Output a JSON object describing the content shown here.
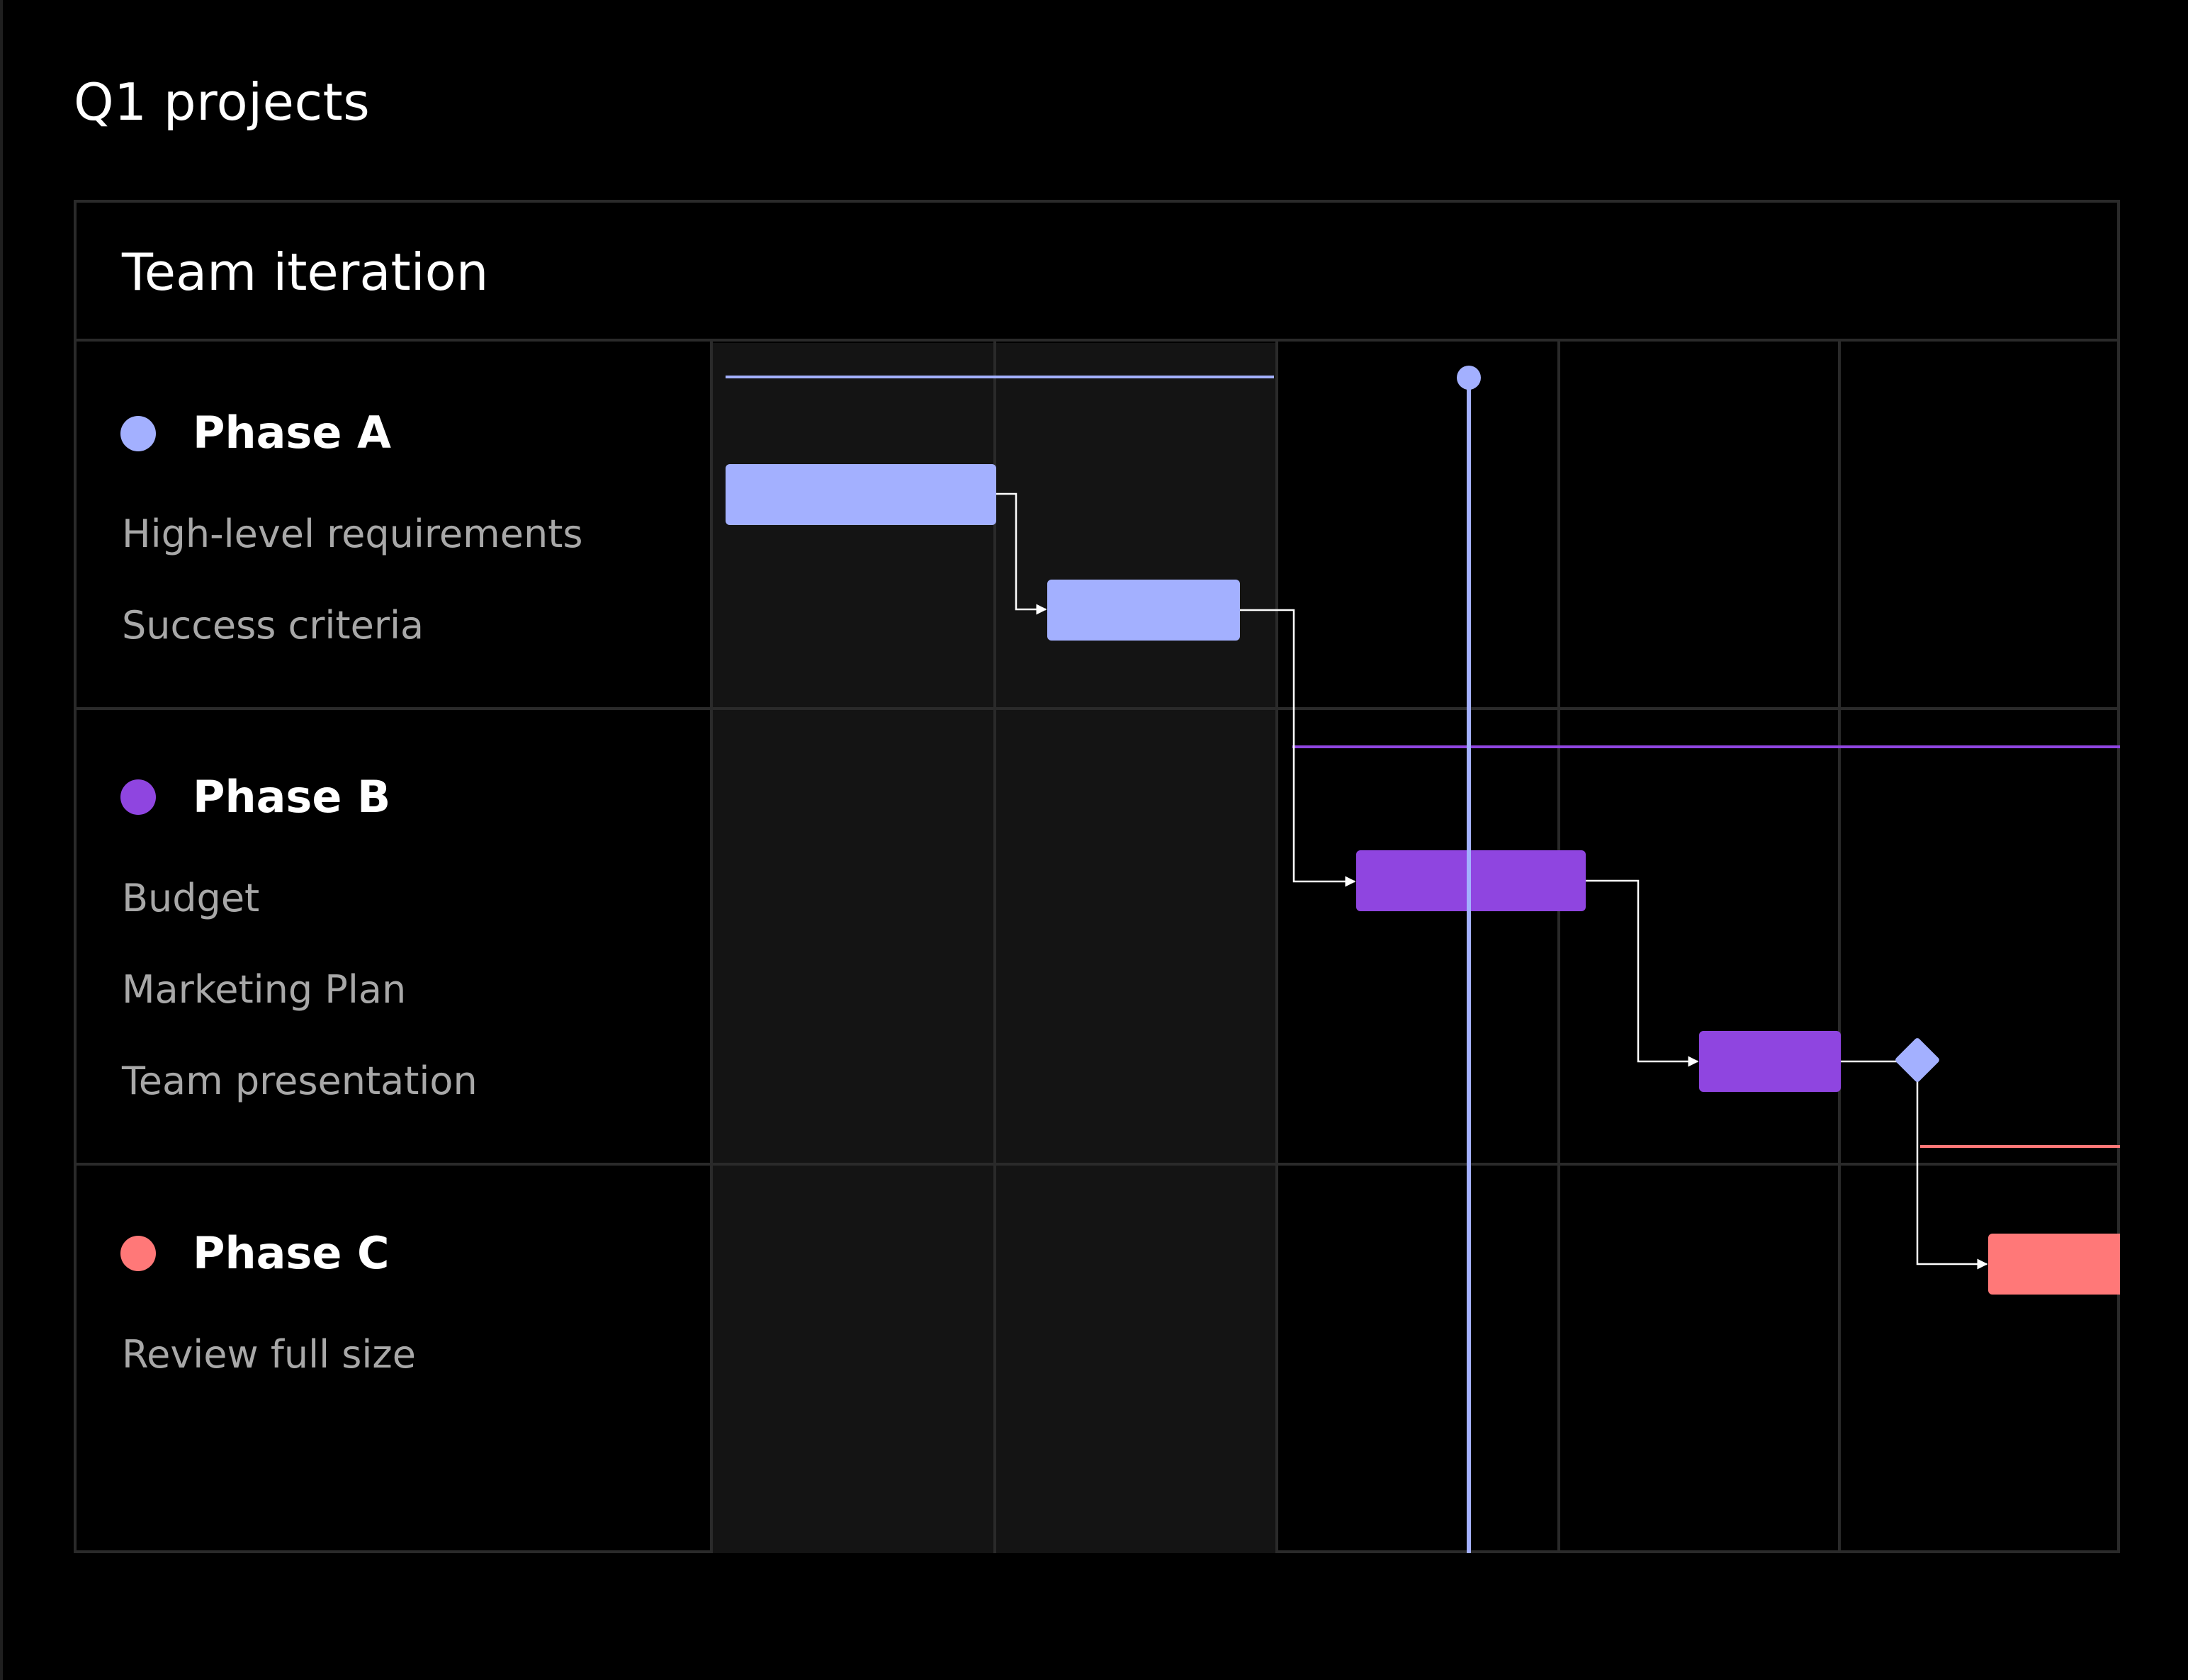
{
  "page": {
    "title": "Q1 projects"
  },
  "card": {
    "title": "Team iteration"
  },
  "phases": [
    {
      "label": "Phase A",
      "color": "#a3b0ff",
      "tasks": [
        "High-level requirements",
        "Success criteria"
      ]
    },
    {
      "label": "Phase B",
      "color": "#8f45e0",
      "tasks": [
        "Budget",
        "Marketing Plan",
        "Team presentation"
      ]
    },
    {
      "label": "Phase C",
      "color": "#ff7878",
      "tasks": [
        "Review full size"
      ]
    }
  ],
  "colors": {
    "background": "#000000",
    "grid": "#2a2a2a",
    "shaded_columns": "#141414",
    "today_marker": "#a3b0ff",
    "milestone": "#a3b0ff",
    "connector": "#ffffff",
    "task_text": "#a8a8a8"
  },
  "icons": {
    "phase_marker": "circle-dot-icon",
    "today_marker": "timeline-marker-icon",
    "milestone": "diamond-milestone-icon"
  }
}
